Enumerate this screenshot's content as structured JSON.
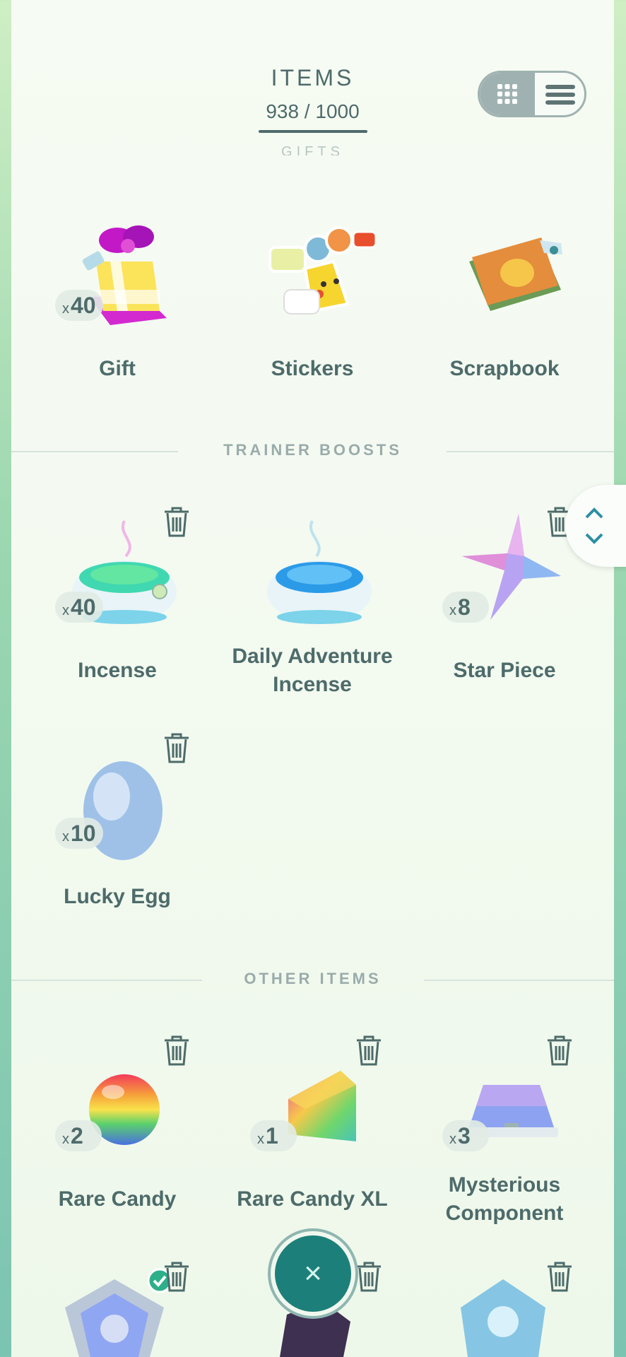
{
  "header": {
    "title": "ITEMS",
    "storage_used": "938",
    "storage_max": "1000",
    "peek_section": "GIFTS"
  },
  "view_toggle": {
    "grid_icon": "grid-icon",
    "list_icon": "list-icon",
    "selected": "grid"
  },
  "sections": {
    "trainer_boosts": "TRAINER BOOSTS",
    "other_items": "OTHER ITEMS"
  },
  "gifts": [
    {
      "name": "Gift",
      "count": "40"
    },
    {
      "name": "Stickers"
    },
    {
      "name": "Scrapbook"
    }
  ],
  "trainer_boosts": [
    {
      "name": "Incense",
      "count": "40"
    },
    {
      "name": "Daily Adventure Incense"
    },
    {
      "name": "Star Piece",
      "count": "8"
    },
    {
      "name": "Lucky Egg",
      "count": "10"
    }
  ],
  "other_items": [
    {
      "name": "Rare Candy",
      "count": "2"
    },
    {
      "name": "Rare Candy XL",
      "count": "1"
    },
    {
      "name": "Mysterious Component",
      "count": "3"
    }
  ],
  "count_prefix": "x",
  "close_symbol": "×",
  "colors": {
    "text": "#4d6b6a",
    "accent": "#1d7f7a",
    "check": "#2db08a"
  }
}
